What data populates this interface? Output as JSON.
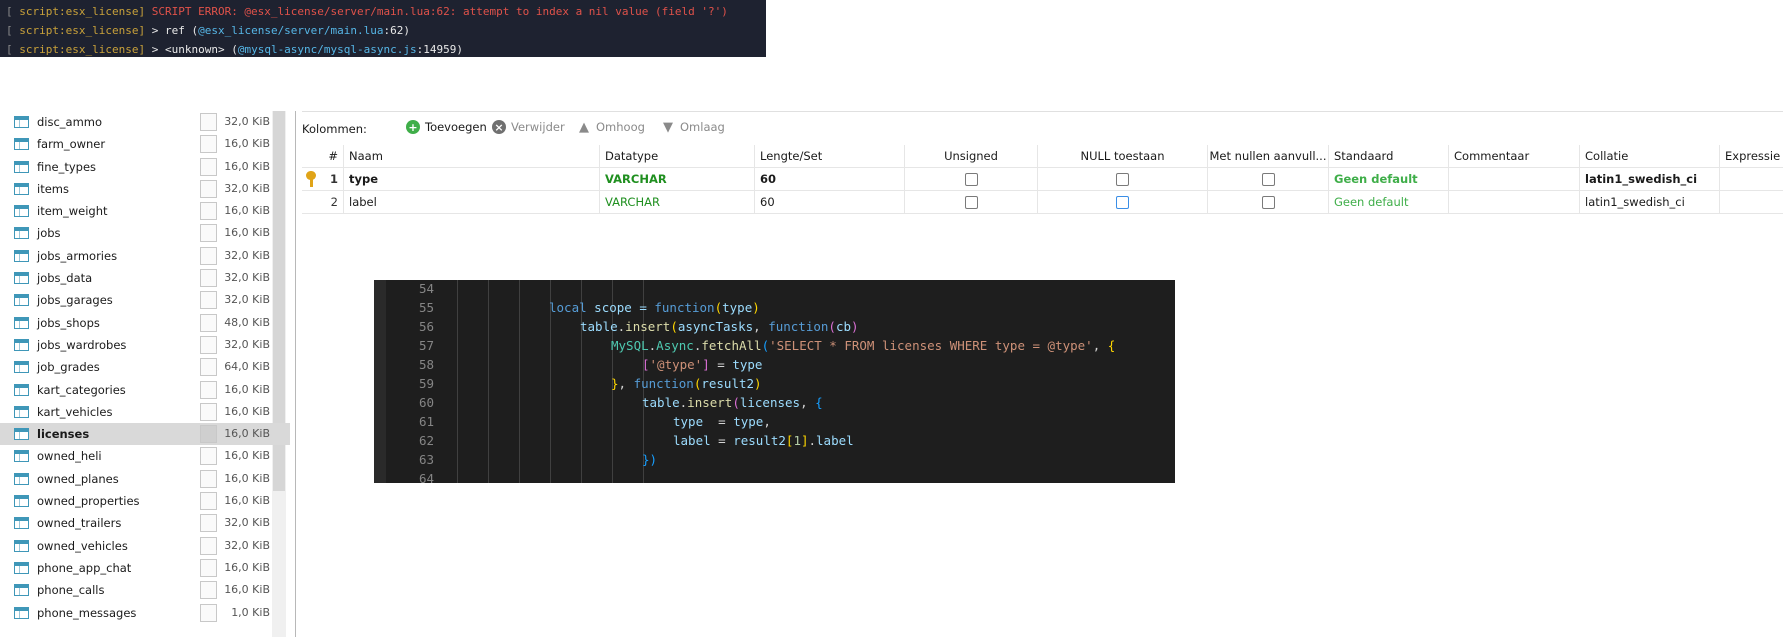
{
  "console": {
    "lines": [
      {
        "prefix": "[",
        "resource": "script:esx_license]",
        "message": "SCRIPT ERROR: @esx_license/server/main.lua:62: attempt to index a nil value (field '?')"
      },
      {
        "prefix": "[",
        "resource": "script:esx_license]",
        "arrow": ">",
        "func": "ref",
        "loc_open": "(",
        "loc_path": "@esx_license/server/main.lua",
        "loc_line": ":62)"
      },
      {
        "prefix": "[",
        "resource": "script:esx_license]",
        "arrow": ">",
        "func": "<unknown>",
        "loc_open": "(",
        "loc_path": "@mysql-async/mysql-async.js",
        "loc_line": ":14959)"
      }
    ]
  },
  "tables": [
    {
      "name": "disc_ammo",
      "size": "32,0 KiB"
    },
    {
      "name": "farm_owner",
      "size": "16,0 KiB"
    },
    {
      "name": "fine_types",
      "size": "16,0 KiB"
    },
    {
      "name": "items",
      "size": "32,0 KiB"
    },
    {
      "name": "item_weight",
      "size": "16,0 KiB"
    },
    {
      "name": "jobs",
      "size": "16,0 KiB"
    },
    {
      "name": "jobs_armories",
      "size": "32,0 KiB"
    },
    {
      "name": "jobs_data",
      "size": "32,0 KiB"
    },
    {
      "name": "jobs_garages",
      "size": "32,0 KiB"
    },
    {
      "name": "jobs_shops",
      "size": "48,0 KiB"
    },
    {
      "name": "jobs_wardrobes",
      "size": "32,0 KiB"
    },
    {
      "name": "job_grades",
      "size": "64,0 KiB"
    },
    {
      "name": "kart_categories",
      "size": "16,0 KiB"
    },
    {
      "name": "kart_vehicles",
      "size": "16,0 KiB"
    },
    {
      "name": "licenses",
      "size": "16,0 KiB",
      "selected": true
    },
    {
      "name": "owned_heli",
      "size": "16,0 KiB"
    },
    {
      "name": "owned_planes",
      "size": "16,0 KiB"
    },
    {
      "name": "owned_properties",
      "size": "16,0 KiB"
    },
    {
      "name": "owned_trailers",
      "size": "32,0 KiB"
    },
    {
      "name": "owned_vehicles",
      "size": "32,0 KiB"
    },
    {
      "name": "phone_app_chat",
      "size": "16,0 KiB"
    },
    {
      "name": "phone_calls",
      "size": "16,0 KiB"
    },
    {
      "name": "phone_messages",
      "size": "1,0 KiB"
    }
  ],
  "toolbar": {
    "label": "Kolommen:",
    "add": "Toevoegen",
    "remove": "Verwijder",
    "up": "Omhoog",
    "down": "Omlaag"
  },
  "columns": {
    "headers": {
      "num": "#",
      "name": "Naam",
      "type": "Datatype",
      "length": "Lengte/Set",
      "unsigned": "Unsigned",
      "null": "NULL toestaan",
      "zerofill": "Met nullen aanvull...",
      "default": "Standaard",
      "comment": "Commentaar",
      "collation": "Collatie",
      "expression": "Expressie"
    },
    "rows": [
      {
        "num": "1",
        "name": "type",
        "type": "VARCHAR",
        "length": "60",
        "default": "Geen default",
        "collation": "latin1_swedish_ci",
        "primary_key": true
      },
      {
        "num": "2",
        "name": "label",
        "type": "VARCHAR",
        "length": "60",
        "default": "Geen default",
        "collation": "latin1_swedish_ci"
      }
    ]
  },
  "code": {
    "line_numbers": [
      "54",
      "55",
      "56",
      "57",
      "58",
      "59",
      "60",
      "61",
      "62",
      "63",
      "64"
    ],
    "l55": {
      "a": "local",
      "b": " scope = ",
      "c": "function",
      "d": "(",
      "e": "type",
      "f": ")"
    },
    "l56": {
      "a": "table",
      "b": ".",
      "c": "insert",
      "d": "(",
      "e": "asyncTasks",
      "f": ", ",
      "g": "function",
      "h": "(",
      "i": "cb",
      "j": ")"
    },
    "l57": {
      "a": "MySQL",
      "b": ".",
      "c": "Async",
      "d": ".",
      "e": "fetchAll",
      "f": "(",
      "g": "'SELECT * FROM licenses WHERE type = @type'",
      "h": ", ",
      "i": "{"
    },
    "l58": {
      "a": "[",
      "b": "'@type'",
      "c": "]",
      "d": " = ",
      "e": "type"
    },
    "l59": {
      "a": "}",
      "b": ", ",
      "c": "function",
      "d": "(",
      "e": "result2",
      "f": ")"
    },
    "l60": {
      "a": "table",
      "b": ".",
      "c": "insert",
      "d": "(",
      "e": "licenses",
      "f": ", ",
      "g": "{"
    },
    "l61": {
      "a": "type",
      "b": "  = ",
      "c": "type",
      "d": ","
    },
    "l62": {
      "a": "label",
      "b": " = ",
      "c": "result2",
      "d": "[",
      "e": "1",
      "f": "]",
      "g": ".",
      "h": "label"
    },
    "l63": {
      "a": "})"
    }
  },
  "colors": {
    "console_bg": "#1e2230",
    "error": "#e0524a",
    "resource": "#c8a13a",
    "path": "#56b6e6",
    "datatype": "#1f8f1f",
    "default_value": "#3fae49",
    "add_button": "#3fae49",
    "key": "#e0a418",
    "code_bg": "#1e1e1e"
  }
}
